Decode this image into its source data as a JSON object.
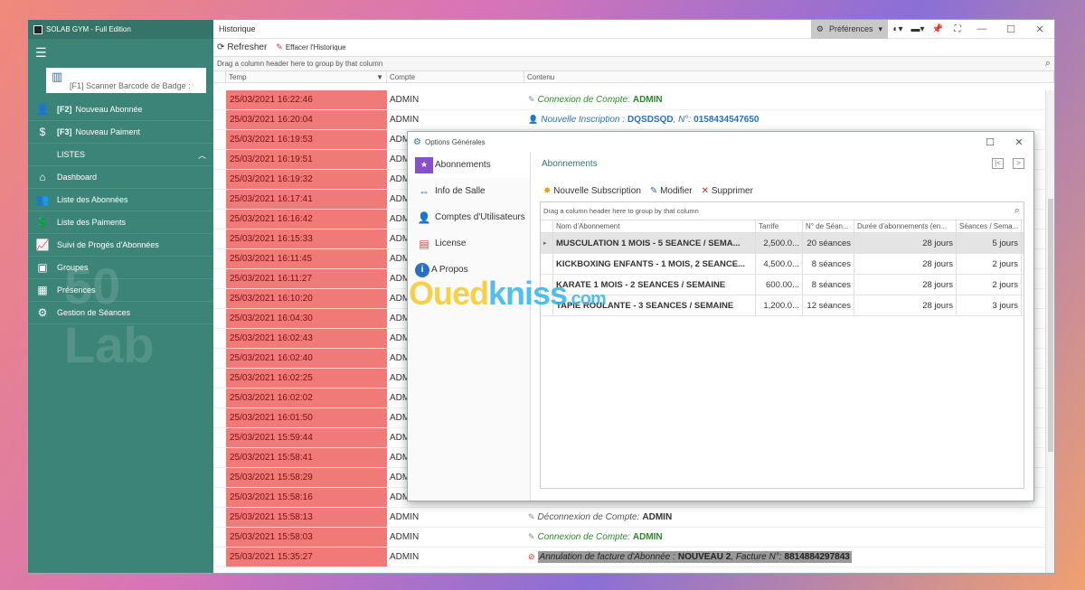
{
  "sidebar": {
    "app_title": "SOLAB GYM - Full Edition",
    "scan_label": "[F1] Scanner Barcode de Badge :",
    "actions": [
      {
        "key": "[F2]",
        "label": "Nouveau Abonnée",
        "icon": "add-user-icon"
      },
      {
        "key": "[F3]",
        "label": "Nouveau Paiment",
        "icon": "dollar-icon"
      }
    ],
    "section_label": "LISTES",
    "items": [
      {
        "label": "Dashboard",
        "icon": "home-icon"
      },
      {
        "label": "Liste des Abonnées",
        "icon": "users-icon"
      },
      {
        "label": "Liste des Paiments",
        "icon": "payments-icon"
      },
      {
        "label": "Suivi de Progés d'Abonnées",
        "icon": "progress-icon"
      },
      {
        "label": "Groupes",
        "icon": "groups-icon"
      },
      {
        "label": "Présences",
        "icon": "presence-icon"
      },
      {
        "label": "Gestion de Séances",
        "icon": "sessions-icon"
      }
    ]
  },
  "main": {
    "title": "Historique",
    "preferences_label": "Préférences",
    "refresh_label": "Refresher",
    "clear_label": "Effacer l'Historique",
    "group_hint": "Drag a column header here to group by that column",
    "columns": {
      "temp": "Temp",
      "compte": "Compte",
      "contenu": "Contenu"
    },
    "rows": [
      {
        "temp": "25/03/2021 16:22:46",
        "compte": "ADMIN",
        "kind": "conn",
        "text": "Connexion de Compte:",
        "bold": "ADMIN"
      },
      {
        "temp": "25/03/2021 16:20:04",
        "compte": "ADMIN",
        "kind": "inst",
        "text": "Nouvelle Inscription :",
        "bold": "DQSDSQD",
        "extra": ", N°:",
        "bold2": "0158434547650"
      },
      {
        "temp": "25/03/2021 16:19:53",
        "compte": "ADMIN",
        "kind": "",
        "text": "",
        "bold": ""
      },
      {
        "temp": "25/03/2021 16:19:51",
        "compte": "ADMIN",
        "kind": "",
        "text": "",
        "bold": ""
      },
      {
        "temp": "25/03/2021 16:19:32",
        "compte": "ADMIN",
        "kind": "",
        "text": "",
        "bold": ""
      },
      {
        "temp": "25/03/2021 16:17:41",
        "compte": "ADMIN",
        "kind": "",
        "text": "",
        "bold": ""
      },
      {
        "temp": "25/03/2021 16:16:42",
        "compte": "ADMIN",
        "kind": "",
        "text": "",
        "bold": ""
      },
      {
        "temp": "25/03/2021 16:15:33",
        "compte": "ADMIN",
        "kind": "",
        "text": "",
        "bold": ""
      },
      {
        "temp": "25/03/2021 16:11:45",
        "compte": "ADMIN",
        "kind": "",
        "text": "",
        "bold": ""
      },
      {
        "temp": "25/03/2021 16:11:27",
        "compte": "ADMIN",
        "kind": "",
        "text": "",
        "bold": ""
      },
      {
        "temp": "25/03/2021 16:10:20",
        "compte": "ADMIN",
        "kind": "",
        "text": "",
        "bold": ""
      },
      {
        "temp": "25/03/2021 16:04:30",
        "compte": "ADMIN",
        "kind": "",
        "text": "",
        "bold": ""
      },
      {
        "temp": "25/03/2021 16:02:43",
        "compte": "ADMIN",
        "kind": "",
        "text": "",
        "bold": ""
      },
      {
        "temp": "25/03/2021 16:02:40",
        "compte": "ADMIN",
        "kind": "",
        "text": "",
        "bold": ""
      },
      {
        "temp": "25/03/2021 16:02:25",
        "compte": "ADMIN",
        "kind": "",
        "text": "",
        "bold": ""
      },
      {
        "temp": "25/03/2021 16:02:02",
        "compte": "ADMIN",
        "kind": "",
        "text": "",
        "bold": ""
      },
      {
        "temp": "25/03/2021 16:01:50",
        "compte": "ADMIN",
        "kind": "",
        "text": "",
        "bold": ""
      },
      {
        "temp": "25/03/2021 15:59:44",
        "compte": "ADMIN",
        "kind": "",
        "text": "",
        "bold": ""
      },
      {
        "temp": "25/03/2021 15:58:41",
        "compte": "ADMIN",
        "kind": "",
        "text": "",
        "bold": ""
      },
      {
        "temp": "25/03/2021 15:58:29",
        "compte": "ADMIN",
        "kind": "",
        "text": "",
        "bold": ""
      },
      {
        "temp": "25/03/2021 15:58:16",
        "compte": "ADMIN",
        "kind": "",
        "text": "",
        "bold": ""
      },
      {
        "temp": "25/03/2021 15:58:13",
        "compte": "ADMIN",
        "kind": "dec",
        "text": "Déconnexion de Compte:",
        "bold": "ADMIN"
      },
      {
        "temp": "25/03/2021 15:58:03",
        "compte": "ADMIN",
        "kind": "conn",
        "text": "Connexion de Compte:",
        "bold": "ADMIN"
      },
      {
        "temp": "25/03/2021 15:35:27",
        "compte": "ADMIN",
        "kind": "ann",
        "text": "Annulation de facture d'Abonnée :",
        "bold": "NOUVEAU 2",
        "extra": ", Facture N°:",
        "bold2": "8814884297843"
      }
    ]
  },
  "dialog": {
    "title": "Options Générales",
    "nav": [
      {
        "label": "Abonnements",
        "icon": "membership-icon"
      },
      {
        "label": "Info de Salle",
        "icon": "gym-info-icon"
      },
      {
        "label": "Comptes d'Utilisateurs",
        "icon": "user-accounts-icon"
      },
      {
        "label": "License",
        "icon": "license-icon"
      },
      {
        "label": "A Propos",
        "icon": "info-icon"
      }
    ],
    "section_title": "Abonnements",
    "new_label": "Nouvelle Subscription",
    "edit_label": "Modifier",
    "delete_label": "Supprimer",
    "group_hint": "Drag a column header here to group by that column",
    "columns": [
      "Nom d'Abonnement",
      "Tarrife",
      "N° de Séan...",
      "Durée d'abonnements (en...",
      "Séances / Sema..."
    ],
    "rows": [
      [
        "MUSCULATION 1 MOIS - 5 SEANCE / SEMA...",
        "2,500.0...",
        "20 séances",
        "28 jours",
        "5 jours"
      ],
      [
        "KICKBOXING ENFANTS - 1 MOIS, 2 SEANCE...",
        "4,500.0...",
        "8 séances",
        "28 jours",
        "2 jours"
      ],
      [
        "KARATE 1 MOIS - 2 SEANCES / SEMAINE",
        "600.00...",
        "8 séances",
        "28 jours",
        "2 jours"
      ],
      [
        "TAPIE ROULANTE - 3 SEANCES / SEMAINE",
        "1,200.0...",
        "12 séances",
        "28 jours",
        "3 jours"
      ]
    ]
  },
  "watermark": {
    "part1": "Oued",
    "part2": "kniss",
    "part3": ".com"
  }
}
